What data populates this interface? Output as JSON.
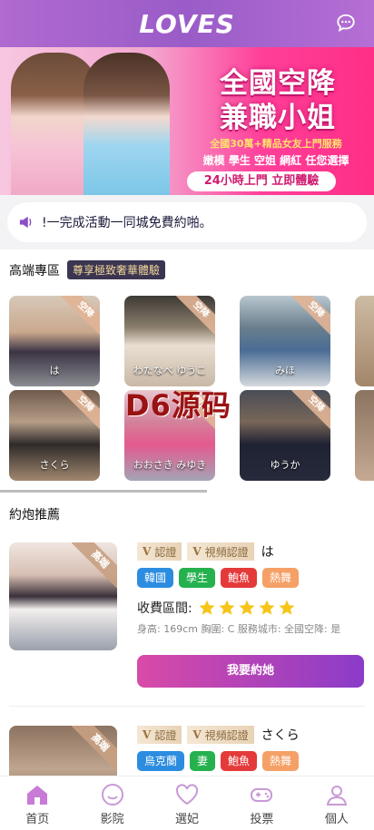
{
  "header": {
    "title": "LOVES",
    "chat_icon": "chat-bubble-icon"
  },
  "banner": {
    "headline1": "全國空降",
    "headline2": "兼職小姐",
    "line1": "全國30萬+精品女友上門服務",
    "line2": "嫩模 學生 空姐 網紅 任您選擇",
    "pill": "24小時上門 立即體驗"
  },
  "notice": {
    "icon": "speaker-icon",
    "text": "!一完成活動一同城免費約啪。"
  },
  "premium": {
    "title": "高端專區",
    "badge": "尊享極致奢華體驗",
    "ribbon": "空降",
    "cards": [
      {
        "name": "は"
      },
      {
        "name": "わたなべ ゆうこ"
      },
      {
        "name": "みほ"
      },
      {
        "name": ""
      },
      {
        "name": "さくら"
      },
      {
        "name": "おおさき みゆき"
      },
      {
        "name": "ゆうか"
      },
      {
        "name": ""
      }
    ]
  },
  "watermark": "D6源码",
  "recommend": {
    "title": "約炮推薦",
    "items": [
      {
        "ribbon": "高端",
        "cert1": "認證",
        "cert2": "視頻認證",
        "name": "は",
        "tags": [
          "韓國",
          "學生",
          "鮑魚",
          "熱舞"
        ],
        "price_label": "收費區間:",
        "rating": 5,
        "info": "身高: 169cm 胸圍: C 服務城市: 全國空降: 是",
        "cta": "我要約她"
      },
      {
        "ribbon": "高端",
        "cert1": "認證",
        "cert2": "視頻認證",
        "name": "さくら",
        "tags": [
          "烏克蘭",
          "妻",
          "鮑魚",
          "熱舞"
        ]
      }
    ]
  },
  "tabs": [
    {
      "label": "首页",
      "icon": "home-icon",
      "active": true
    },
    {
      "label": "影院",
      "icon": "smile-icon"
    },
    {
      "label": "選妃",
      "icon": "heart-icon"
    },
    {
      "label": "投票",
      "icon": "gamepad-icon"
    },
    {
      "label": "個人",
      "icon": "user-icon"
    }
  ],
  "colors": {
    "header": "#9a5cc8",
    "accent": "#d94aa8",
    "purple": "#8b3cc8"
  }
}
